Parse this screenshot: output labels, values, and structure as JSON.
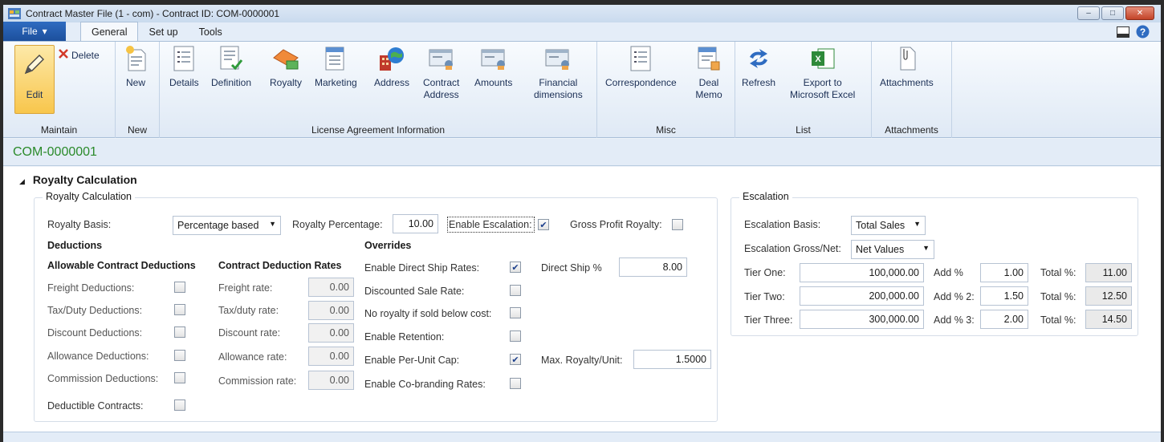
{
  "window": {
    "title": "Contract Master File (1 - com) - Contract ID: COM-0000001",
    "controls": {
      "minimize": "–",
      "maximize": "□",
      "close": "✕"
    }
  },
  "menu": {
    "file_label": "File",
    "tabs": [
      "General",
      "Set up",
      "Tools"
    ]
  },
  "ribbon": {
    "maintain": {
      "edit": "Edit",
      "delete": "Delete",
      "group": "Maintain"
    },
    "new": {
      "new": "New",
      "group": "New"
    },
    "license": {
      "details": "Details",
      "definition": "Definition",
      "royalty": "Royalty",
      "marketing": "Marketing",
      "address": "Address",
      "contract_address_1": "Contract",
      "contract_address_2": "Address",
      "amounts": "Amounts",
      "financial_1": "Financial",
      "financial_2": "dimensions",
      "group": "License Agreement Information"
    },
    "misc": {
      "correspondence": "Correspondence",
      "deal_memo_1": "Deal",
      "deal_memo_2": "Memo",
      "group": "Misc"
    },
    "list": {
      "refresh": "Refresh",
      "export_1": "Export to",
      "export_2": "Microsoft Excel",
      "group": "List"
    },
    "attachments": {
      "attachments": "Attachments",
      "group": "Attachments"
    }
  },
  "record": {
    "id": "COM-0000001"
  },
  "section": {
    "title": "Royalty Calculation"
  },
  "royalty": {
    "legend": "Royalty Calculation",
    "basis_label": "Royalty Basis:",
    "basis_value": "Percentage based",
    "percentage_label": "Royalty Percentage:",
    "percentage_value": "10.00",
    "enable_escalation_label": "Enable Escalation:",
    "enable_escalation": true,
    "gross_profit_label": "Gross Profit Royalty:",
    "gross_profit": false,
    "deductions_title": "Deductions",
    "allowable_title": "Allowable Contract Deductions",
    "rates_title": "Contract Deduction Rates",
    "deductions": [
      {
        "label": "Freight Deductions:",
        "checked": false,
        "rate_label": "Freight rate:",
        "rate": "0.00"
      },
      {
        "label": "Tax/Duty Deductions:",
        "checked": false,
        "rate_label": "Tax/duty rate:",
        "rate": "0.00"
      },
      {
        "label": "Discount Deductions:",
        "checked": false,
        "rate_label": "Discount rate:",
        "rate": "0.00"
      },
      {
        "label": "Allowance Deductions:",
        "checked": false,
        "rate_label": "Allowance rate:",
        "rate": "0.00"
      },
      {
        "label": "Commission Deductions:",
        "checked": false,
        "rate_label": "Commission rate:",
        "rate": "0.00"
      }
    ],
    "deductible_contracts_label": "Deductible Contracts:",
    "deductible_contracts": false,
    "overrides_title": "Overrides",
    "overrides": [
      {
        "label": "Enable Direct Ship Rates:",
        "checked": true
      },
      {
        "label": "Discounted Sale Rate:",
        "checked": false
      },
      {
        "label": "No royalty if sold below cost:",
        "checked": false
      },
      {
        "label": "Enable Retention:",
        "checked": false
      },
      {
        "label": "Enable Per-Unit Cap:",
        "checked": true
      },
      {
        "label": "Enable Co-branding Rates:",
        "checked": false
      }
    ],
    "direct_ship_label": "Direct Ship %",
    "direct_ship_value": "8.00",
    "max_royalty_label": "Max. Royalty/Unit:",
    "max_royalty_value": "1.5000"
  },
  "escalation": {
    "legend": "Escalation",
    "basis_label": "Escalation Basis:",
    "basis_value": "Total Sales",
    "gross_net_label": "Escalation Gross/Net:",
    "gross_net_value": "Net Values",
    "tiers": [
      {
        "label": "Tier One:",
        "amount": "100,000.00",
        "add_label": "Add %",
        "add": "1.00",
        "total_label": "Total %:",
        "total": "11.00"
      },
      {
        "label": "Tier Two:",
        "amount": "200,000.00",
        "add_label": "Add % 2:",
        "add": "1.50",
        "total_label": "Total %:",
        "total": "12.50"
      },
      {
        "label": "Tier Three:",
        "amount": "300,000.00",
        "add_label": "Add % 3:",
        "add": "2.00",
        "total_label": "Total %:",
        "total": "14.50"
      }
    ]
  },
  "colors": {
    "accent": "#1c4f9c",
    "record_id": "#2a8a2a",
    "edit_highlight": "#f8c64c"
  }
}
